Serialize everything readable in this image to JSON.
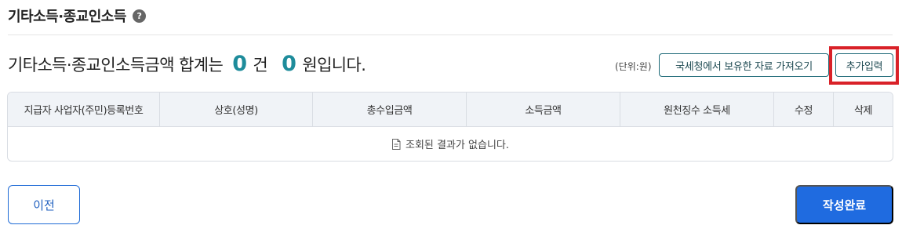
{
  "section": {
    "title": "기타소득·종교인소득",
    "help_icon": "question-circle-icon"
  },
  "summary": {
    "prefix": "기타소득·종교인소득금액 합계는",
    "count": "0",
    "count_unit": "건",
    "amount": "0",
    "amount_unit": "원입니다.",
    "accent_color": "#1e8c9b"
  },
  "toolbar": {
    "unit_label": "(단위:원)",
    "fetch_nts_label": "국세청에서 보유한 자료 가져오기",
    "add_input_label": "추가입력"
  },
  "table": {
    "columns": [
      "지급자 사업자(주민)등록번호",
      "상호(성명)",
      "총수입금액",
      "소득금액",
      "원천징수 소득세",
      "수정",
      "삭제"
    ],
    "empty_message": "조회된 결과가 없습니다.",
    "empty_icon": "document-icon"
  },
  "footer": {
    "prev_label": "이전",
    "complete_label": "작성완료",
    "primary_color": "#1f6be0"
  },
  "annotation": {
    "highlight_color": "#d92128"
  }
}
